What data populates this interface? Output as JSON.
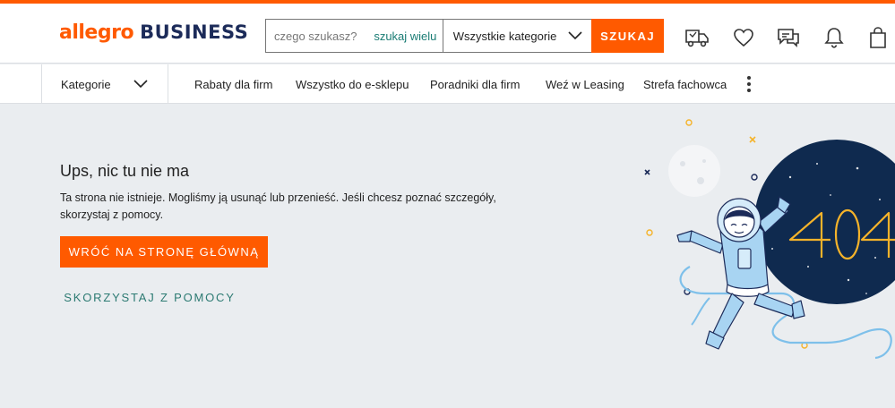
{
  "header": {
    "logo_primary": "allegro",
    "logo_secondary": "BUSINESS",
    "search": {
      "placeholder": "czego szukasz?",
      "multi_search_label": "szukaj wielu",
      "category_selected": "Wszystkie kategorie",
      "submit_label": "SZUKAJ"
    },
    "icons": [
      "delivery-truck-icon",
      "heart-icon",
      "messages-icon",
      "bell-icon",
      "shopping-bag-icon"
    ]
  },
  "nav": {
    "categories_label": "Kategorie",
    "links": [
      "Rabaty dla firm",
      "Wszystko do e-sklepu",
      "Poradniki dla firm",
      "Weź w Leasing",
      "Strefa fachowca"
    ]
  },
  "error": {
    "title": "Ups, nic tu nie ma",
    "description": "Ta strona nie istnieje. Mogliśmy ją usunąć lub przenieść. Jeśli chcesz poznać szczegóły, skorzystaj z pomocy.",
    "home_button": "WRÓĆ NA STRONĘ GŁÓWNĄ",
    "help_link": "SKORZYSTAJ Z POMOCY"
  },
  "illustration": {
    "code": "404",
    "icon": "astronaut-404-illustration"
  },
  "colors": {
    "accent": "#ff5a00",
    "brand_dark": "#1c2b59",
    "link_teal": "#2c7a72",
    "background": "#eaedf0",
    "space_dark": "#0f2a4f",
    "astronaut_blue": "#a8d4f2",
    "digits_yellow": "#f5b32a"
  }
}
